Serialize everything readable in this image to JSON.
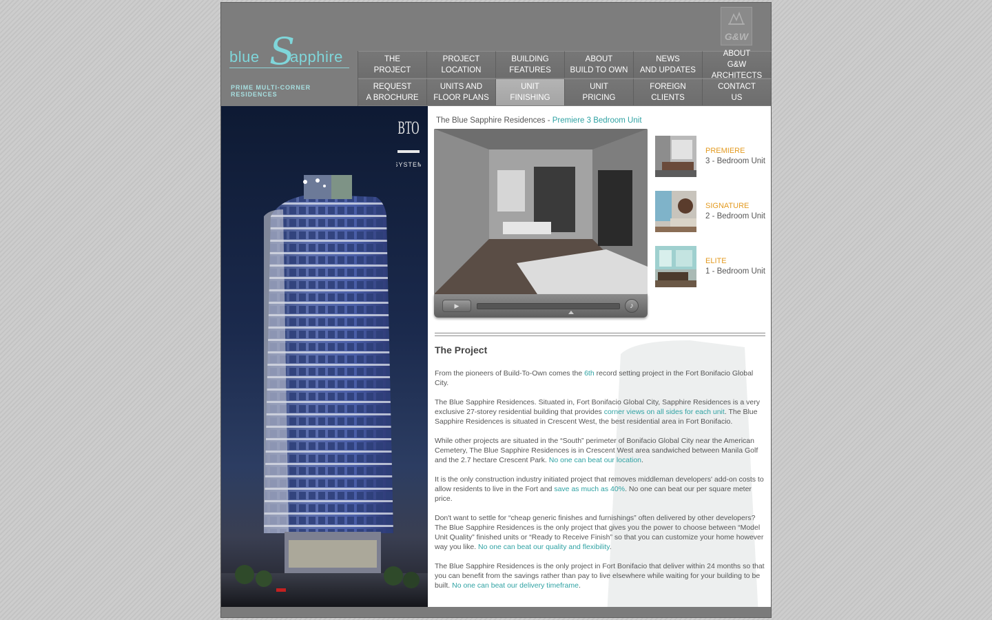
{
  "brand": {
    "logo_word_left": "blue",
    "logo_S": "S",
    "logo_word_right": "apphire",
    "tagline": "PRIME MULTI-CORNER RESIDENCES",
    "architect_logo": "G&W",
    "accent_color": "#2fa2a3"
  },
  "nav": {
    "items": [
      {
        "label": "THE\nPROJECT"
      },
      {
        "label": "PROJECT\nLOCATION"
      },
      {
        "label": "BUILDING\nFEATURES"
      },
      {
        "label": "ABOUT\nBUILD TO OWN"
      },
      {
        "label": "NEWS\nAND UPDATES"
      },
      {
        "label": "ABOUT\nG&W ARCHITECTS"
      },
      {
        "label": "REQUEST\nA BROCHURE"
      },
      {
        "label": "UNITS AND\nFLOOR PLANS"
      },
      {
        "label": "UNIT\nFINISHING"
      },
      {
        "label": "UNIT\nPRICING"
      },
      {
        "label": "FOREIGN\nCLIENTS"
      },
      {
        "label": "CONTACT\nUS"
      }
    ],
    "active_label": "UNIT FINISHING"
  },
  "hero": {
    "bto_logo": "BTO SYSTEM"
  },
  "video": {
    "crumb_prefix": "The Blue Sapphire Residences - ",
    "crumb_highlight": "Premiere 3 Bedroom Unit",
    "play_icon": "play-icon",
    "volume_icon": "volume-icon"
  },
  "units": [
    {
      "name": "PREMIERE",
      "desc": "3 - Bedroom Unit"
    },
    {
      "name": "SIGNATURE",
      "desc": "2 - Bedroom Unit"
    },
    {
      "name": "ELITE",
      "desc": "1 - Bedroom Unit"
    }
  ],
  "article": {
    "title": "The Project",
    "p1_a": "From the pioneers of Build-To-Own comes the ",
    "p1_hl": "6th",
    "p1_b": " record setting project in the Fort Bonifacio Global City.",
    "p2_a": "The Blue Sapphire Residences. Situated in, Fort Bonifacio Global City, Sapphire Residences is a very exclusive 27-storey residential building that provides ",
    "p2_hl": "corner views on all sides for each unit",
    "p2_b": ". The Blue Sapphire Residences is situated in Crescent West, the best residential area in Fort Bonifacio.",
    "p3_a": "While other projects are situated in the “South” perimeter of Bonifacio Global City near the American Cemetery, The Blue Sapphire Residences is in Crescent West area sandwiched between Manila Golf and the 2.7 hectare Crescent Park. ",
    "p3_hl": "No one can beat our location",
    "p3_b": ".",
    "p4_a": "It is the only construction industry initiated project that removes middleman developers' add-on costs to allow residents to live in the Fort and ",
    "p4_hl": "save as much as 40%",
    "p4_b": ". No one can beat our per square meter price.",
    "p5_a": "Don't want to settle for “cheap generic finishes and furnishings” often delivered by other developers? The Blue Sapphire Residences is the only project that gives you the power to choose between “Model Unit Quality” finished units or “Ready to Receive Finish” so that you can customize your home however way you like. ",
    "p5_hl": "No one can beat our quality and flexibility",
    "p5_b": ".",
    "p6_a": "The Blue Sapphire Residences is the only project in Fort Bonifacio that deliver within 24 months so that you can benefit from the savings rather than pay to live elsewhere while waiting for your building to be built. ",
    "p6_hl": "No one can beat our delivery timeframe",
    "p6_b": "."
  }
}
